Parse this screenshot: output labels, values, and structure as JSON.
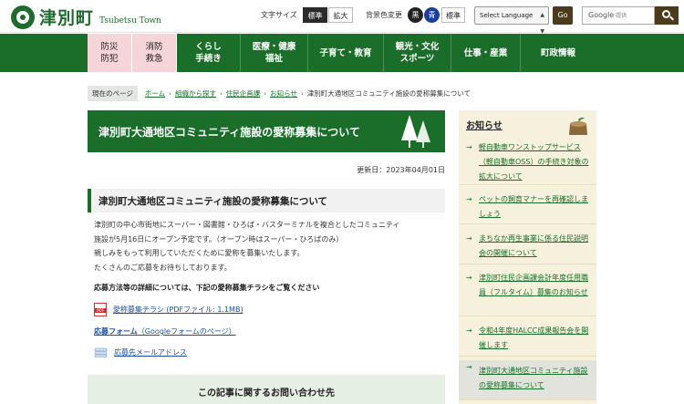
{
  "header": {
    "logo_name": "津別町",
    "logo_sub": "Tsubetsu Town",
    "text_size_label": "文字サイズ",
    "text_size_standard": "標準",
    "text_size_large": "拡大",
    "bg_color_label": "背景色変更",
    "bg_black": "黒",
    "bg_blue": "青",
    "bg_standard": "標準",
    "language_select": "Select Language",
    "go_button": "Go",
    "search_placeholder": "Google",
    "search_suffix": "提供"
  },
  "nav": {
    "items": [
      {
        "label1": "防災",
        "label2": "防犯"
      },
      {
        "label1": "消防",
        "label2": "救急"
      },
      {
        "label1": "くらし",
        "label2": "手続き"
      },
      {
        "label1": "医療・健康",
        "label2": "福祉"
      },
      {
        "label1": "子育て・教育",
        "label2": ""
      },
      {
        "label1": "観光・文化",
        "label2": "スポーツ"
      },
      {
        "label1": "仕事・産業",
        "label2": ""
      },
      {
        "label1": "町政情報",
        "label2": ""
      }
    ]
  },
  "breadcrumb": {
    "here": "現在のページ",
    "links": [
      "ホーム",
      "組織から探す",
      "住民企画課",
      "お知らせ"
    ],
    "current": "津別町大通地区コミュニティ施設の愛称募集について"
  },
  "article": {
    "title": "津別町大通地区コミュニティ施設の愛称募集について",
    "updated": "更新日：2023年04月01日",
    "subhead": "津別町大通地区コミュニティ施設の愛称募集について",
    "body": [
      "津別町の中心市街地にスーパー・図書館・ひろば・バスターミナルを複合としたコミュニティ",
      "施設が5月16日にオープン予定です。（オープン時はスーパー・ひろばのみ）",
      "親しみをもって利用していただくために愛称を募集いたします。",
      "たくさんのご応募をお待ちしております。"
    ],
    "details_note": "応募方法等の詳細については、下記の愛称募集チラシをご覧ください",
    "pdf_link": "愛称募集チラシ (PDFファイル: 1.1MB)",
    "form_link": "応募フォーム",
    "form_note": "（Googleフォームのページ）",
    "mail_link": "応募先メールアドレス",
    "contact_heading": "この記事に関するお問い合わせ先"
  },
  "sidebar": {
    "title": "お知らせ",
    "items": [
      "軽自動車ワンストップサービス（軽自動車OSS）の手続き対象の拡大について",
      "ペットの飼育マナーを再確認しましょう",
      "まちなか再生事業に係る住民説明会の開催について",
      "津別町住民企画課会計年度任用職員（フルタイム）募集のお知らせ",
      "令和4年度HALCC成果報告会を開催します",
      "津別町大通地区コミュニティ施設の愛称募集について"
    ]
  },
  "colors": {
    "brand_green": "#1a6e2a",
    "nav_pink": "#f6d5da",
    "sidebar_bg": "#f6f1dc",
    "link_blue": "#1a4fa0"
  }
}
